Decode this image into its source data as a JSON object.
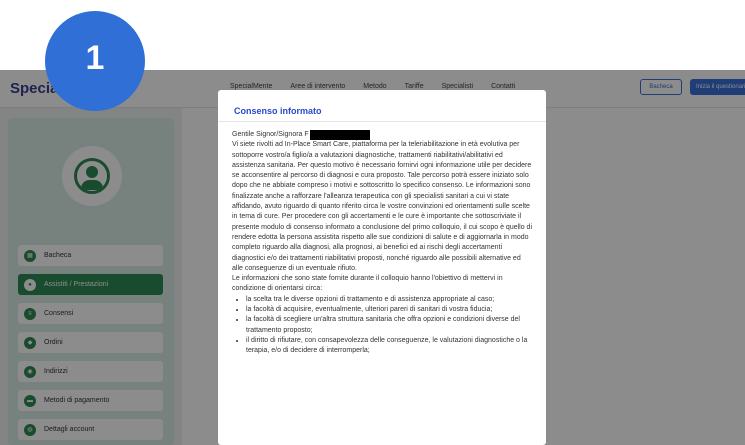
{
  "navbar": {
    "logo": "SpecialM",
    "links": [
      "SpecialMente",
      "Aree di intervento",
      "Metodo",
      "Tariffe",
      "Specialisti",
      "Contatti"
    ],
    "bacheca_button": "Bacheca",
    "start_button": "Inizia il questionario"
  },
  "sidebar": {
    "items": [
      {
        "label": "Bacheca",
        "icon": "dashboard-icon"
      },
      {
        "label": "Assistiti / Prestazioni",
        "icon": "users-icon",
        "active": true
      },
      {
        "label": "Consensi",
        "icon": "document-icon"
      },
      {
        "label": "Ordini",
        "icon": "cart-icon"
      },
      {
        "label": "Indirizzi",
        "icon": "location-icon"
      },
      {
        "label": "Metodi di pagamento",
        "icon": "card-icon"
      },
      {
        "label": "Dettagli account",
        "icon": "account-icon"
      }
    ]
  },
  "badge": {
    "number": "1"
  },
  "modal": {
    "title": "Consenso informato",
    "greeting": "Gentile Signor/Signora F",
    "paragraph1": "Vi siete rivolti ad In-Place Smart Care, piattaforma per la teleriabilitazione in età evolutiva per sottoporre vostro/a figlio/a a valutazioni diagnostiche, trattamenti riabilitativi/abilitativi ed assistenza sanitaria. Per questo motivo è necessario fornirvi ogni informazione utile per decidere se acconsentire al percorso di diagnosi e cura proposto. Tale percorso potrà essere iniziato solo dopo che ne abbiate compreso i motivi e sottoscritto lo specifico consenso. Le informazioni sono finalizzate anche a rafforzare l'alleanza terapeutica con gli specialisti sanitari a cui vi state affidando, avuto riguardo di quanto riferito circa le vostre convinzioni ed orientamenti sulle scelte in tema di cure. Per procedere con gli accertamenti e le cure è importante che sottoscriviate il presente modulo di consenso informato a conclusione del primo colloquio, il cui scopo è quello di rendere edotta la persona assistita rispetto alle sue condizioni di salute e di aggiornarla in modo completo riguardo alla diagnosi, alla prognosi, ai benefici ed ai rischi degli accertamenti diagnostici e/o dei trattamenti riabilitativi proposti, nonché riguardo alle possibili alternative ed alle conseguenze di un eventuale rifiuto.",
    "paragraph2": "Le informazioni che sono state fornite durante il colloquio hanno l'obiettivo di mettervi in condizione di orientarsi circa:",
    "bullets": [
      "la scelta tra le diverse opzioni di trattamento e di assistenza appropriate al caso;",
      "la facoltà di acquisire, eventualmente, ulteriori pareri di sanitari di vostra fiducia;",
      "la facoltà di scegliere un'altra struttura sanitaria che offra opzioni e condizioni diverse del trattamento proposto;",
      "il diritto di rifiutare, con consapevolezza delle conseguenze, le valutazioni diagnostiche o la terapia, e/o di decidere di interromperla;"
    ]
  },
  "colors": {
    "accent_blue": "#2a49c8",
    "badge_blue": "#2f6fd6",
    "sidebar_green": "#2f8a55"
  }
}
